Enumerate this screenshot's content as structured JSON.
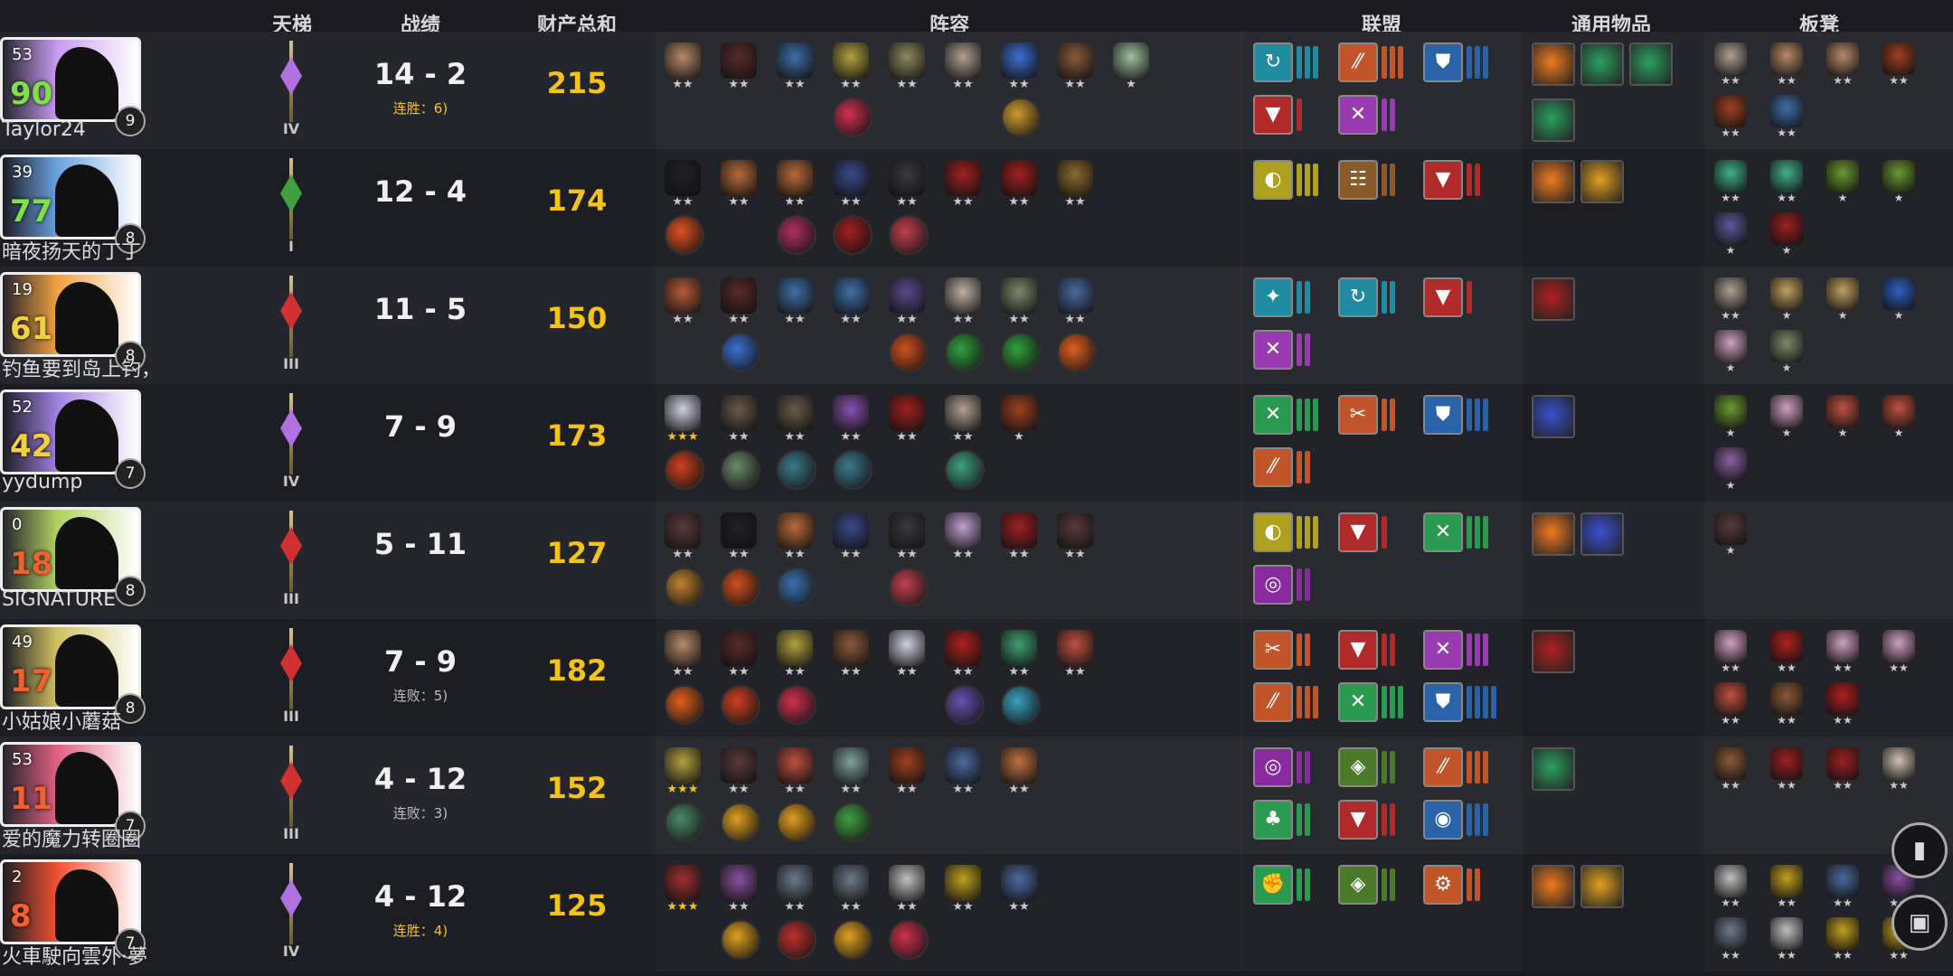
{
  "headers": {
    "ladder": "天梯",
    "record": "战绩",
    "networth": "财产总和",
    "lineup": "阵容",
    "alliances": "联盟",
    "items": "通用物品",
    "bench": "板凳"
  },
  "players": [
    {
      "level": "53",
      "hp": "90",
      "hp_color": "#7ee04a",
      "badge": "9",
      "name": "Taylor24",
      "portrait_color": "#c89af0",
      "rank": "IV",
      "rank_color": "#b070e0",
      "record": "14 - 2",
      "streak": "连胜：6)",
      "streak_type": "win",
      "gold": "215",
      "units": [
        [
          "#b88a6a",
          2
        ],
        [
          "#5a2a2a",
          2
        ],
        [
          "#3f6fa8",
          2
        ],
        [
          "#b4a040",
          2
        ],
        [
          "#8f8a5e",
          2
        ],
        [
          "#b0a090",
          2
        ],
        [
          "#3d6fd0",
          2
        ],
        [
          "#8a5a3a",
          2
        ],
        [
          "#a0c0a0",
          1
        ]
      ],
      "uitems": [
        {
          "slot": 3,
          "color": "#d03050"
        },
        {
          "slot": 6,
          "color": "#d09a30"
        }
      ],
      "syn": [
        {
          "c": "#1f8aa0",
          "g": "↻",
          "n": 3
        },
        {
          "c": "#c2542a",
          "g": "⁄⁄",
          "n": 3
        },
        {
          "c": "#2a62a8",
          "g": "⛊",
          "n": 3
        },
        {
          "c": "#b02a2a",
          "g": "▼",
          "n": 1
        },
        {
          "c": "#9a3ab0",
          "g": "✕",
          "n": 2
        }
      ],
      "gitems": [
        "#f07a20",
        "#2aa060",
        "#2aa060",
        "#2aa060"
      ],
      "bench": [
        [
          "#b0a090",
          2
        ],
        [
          "#b88a6a",
          2
        ],
        [
          "#b88a6a",
          2
        ],
        [
          "#a04020",
          2
        ],
        [
          "#a04020",
          2
        ],
        [
          "#3f6fa8",
          2
        ]
      ]
    },
    {
      "level": "39",
      "hp": "77",
      "hp_color": "#7ee04a",
      "badge": "8",
      "name": "暗夜扬天的丁丁",
      "portrait_color": "#6aa0e0",
      "rank": "I",
      "rank_color": "#40a040",
      "record": "12 - 4",
      "streak": "",
      "streak_type": "win",
      "gold": "174",
      "units": [
        [
          "#202028",
          2
        ],
        [
          "#b86a3a",
          2
        ],
        [
          "#b86a3a",
          2
        ],
        [
          "#3a4a8a",
          2
        ],
        [
          "#3a3a40",
          2
        ],
        [
          "#a02020",
          2
        ],
        [
          "#a02020",
          2
        ],
        [
          "#8a6a30",
          2
        ]
      ],
      "uitems": [
        {
          "slot": 0,
          "color": "#e05020"
        },
        {
          "slot": 2,
          "color": "#b03060"
        },
        {
          "slot": 3,
          "color": "#a02020"
        },
        {
          "slot": 4,
          "color": "#c04050"
        }
      ],
      "syn": [
        {
          "c": "#b0a020",
          "g": "◐",
          "n": 3
        },
        {
          "c": "#8a5a2a",
          "g": "☷",
          "n": 2
        },
        {
          "c": "#b02a2a",
          "g": "▼",
          "n": 2
        }
      ],
      "gitems": [
        "#f07a20",
        "#e0a020"
      ],
      "bench": [
        [
          "#40b08a",
          2
        ],
        [
          "#40b08a",
          2
        ],
        [
          "#6a9a30",
          1
        ],
        [
          "#6a9a30",
          1
        ],
        [
          "#5a5a9a",
          1
        ],
        [
          "#a02020",
          1
        ]
      ]
    },
    {
      "level": "19",
      "hp": "61",
      "hp_color": "#f0d040",
      "badge": "8",
      "name": "钓鱼要到岛上钓，",
      "portrait_color": "#f0a040",
      "rank": "III",
      "rank_color": "#d03030",
      "record": "11 - 5",
      "streak": "",
      "streak_type": "win",
      "gold": "150",
      "units": [
        [
          "#b85a3a",
          2
        ],
        [
          "#5a2a2a",
          2
        ],
        [
          "#3f6fa8",
          2
        ],
        [
          "#3f6fa8",
          2
        ],
        [
          "#5a4a8a",
          2
        ],
        [
          "#c0b0a0",
          2
        ],
        [
          "#7a8a6a",
          2
        ],
        [
          "#4a6aa0",
          2
        ]
      ],
      "uitems": [
        {
          "slot": 1,
          "color": "#3a70d0"
        },
        {
          "slot": 4,
          "color": "#d05020"
        },
        {
          "slot": 5,
          "color": "#30a040"
        },
        {
          "slot": 6,
          "color": "#30a040"
        },
        {
          "slot": 7,
          "color": "#e06020"
        }
      ],
      "syn": [
        {
          "c": "#1f8aa0",
          "g": "✦",
          "n": 2
        },
        {
          "c": "#1f8aa0",
          "g": "↻",
          "n": 2
        },
        {
          "c": "#b02a2a",
          "g": "▼",
          "n": 1
        },
        {
          "c": "#9a3ab0",
          "g": "✕",
          "n": 2
        }
      ],
      "gitems": [
        "#b02020"
      ],
      "bench": [
        [
          "#b0a090",
          2
        ],
        [
          "#c0a060",
          1
        ],
        [
          "#c0a060",
          1
        ],
        [
          "#3060c0",
          1
        ],
        [
          "#d0a0c0",
          1
        ],
        [
          "#7a8a6a",
          1
        ]
      ]
    },
    {
      "level": "52",
      "hp": "42",
      "hp_color": "#f0d040",
      "badge": "7",
      "name": "yydump",
      "portrait_color": "#a080e0",
      "rank": "IV",
      "rank_color": "#b070e0",
      "record": "7 - 9",
      "streak": "",
      "streak_type": "win",
      "gold": "173",
      "units": [
        [
          "#d0d0e0",
          3
        ],
        [
          "#6a5a4a",
          2
        ],
        [
          "#6a5a4a",
          2
        ],
        [
          "#8a50b0",
          2
        ],
        [
          "#a02020",
          2
        ],
        [
          "#b0a090",
          2
        ],
        [
          "#a04020",
          1
        ]
      ],
      "uitems": [
        {
          "slot": 0,
          "color": "#d04020"
        },
        {
          "slot": 1,
          "color": "#6a8a6a"
        },
        {
          "slot": 2,
          "color": "#3a7a8a"
        },
        {
          "slot": 3,
          "color": "#3a7a8a"
        },
        {
          "slot": 5,
          "color": "#40a080"
        }
      ],
      "syn": [
        {
          "c": "#2a9a50",
          "g": "✕",
          "n": 3
        },
        {
          "c": "#c2542a",
          "g": "✂",
          "n": 2
        },
        {
          "c": "#2a62a8",
          "g": "⛊",
          "n": 3
        },
        {
          "c": "#c2542a",
          "g": "⁄⁄",
          "n": 2
        }
      ],
      "gitems": [
        "#3a50d0"
      ],
      "bench": [
        [
          "#6a9a30",
          1
        ],
        [
          "#d0a0c0",
          1
        ],
        [
          "#c05040",
          1
        ],
        [
          "#c05040",
          1
        ],
        [
          "#8a60a0",
          1
        ]
      ]
    },
    {
      "level": "0",
      "hp": "18",
      "hp_color": "#f06030",
      "badge": "8",
      "name": "SIGNATURE",
      "portrait_color": "#b0d060",
      "rank": "III",
      "rank_color": "#d03030",
      "record": "5 - 11",
      "streak": "",
      "streak_type": "win",
      "gold": "127",
      "units": [
        [
          "#5a3a3a",
          2
        ],
        [
          "#202028",
          2
        ],
        [
          "#b86a3a",
          2
        ],
        [
          "#3a4a8a",
          2
        ],
        [
          "#3a3a40",
          2
        ],
        [
          "#c0a0d0",
          2
        ],
        [
          "#a02020",
          2
        ],
        [
          "#5a3a3a",
          2
        ]
      ],
      "uitems": [
        {
          "slot": 0,
          "color": "#c08030"
        },
        {
          "slot": 1,
          "color": "#d05020"
        },
        {
          "slot": 2,
          "color": "#3a70b0"
        },
        {
          "slot": 4,
          "color": "#c04050"
        }
      ],
      "syn": [
        {
          "c": "#b0a020",
          "g": "◐",
          "n": 3
        },
        {
          "c": "#b02a2a",
          "g": "▼",
          "n": 1
        },
        {
          "c": "#2a9a50",
          "g": "✕",
          "n": 3
        },
        {
          "c": "#8a2aa0",
          "g": "◎",
          "n": 2
        }
      ],
      "gitems": [
        "#f07a20",
        "#3a50d0"
      ],
      "bench": [
        [
          "#5a3a3a",
          1
        ]
      ]
    },
    {
      "level": "49",
      "hp": "17",
      "hp_color": "#f06030",
      "badge": "8",
      "name": "小姑娘小蘑菇",
      "portrait_color": "#d0c060",
      "rank": "III",
      "rank_color": "#d03030",
      "record": "7 - 9",
      "streak": "连败：5)",
      "streak_type": "loss",
      "gold": "182",
      "units": [
        [
          "#b88a6a",
          2
        ],
        [
          "#5a2a2a",
          2
        ],
        [
          "#b4a040",
          2
        ],
        [
          "#8a5a3a",
          2
        ],
        [
          "#d0d0e0",
          2
        ],
        [
          "#b02020",
          2
        ],
        [
          "#40a070",
          2
        ],
        [
          "#c05040",
          2
        ]
      ],
      "uitems": [
        {
          "slot": 0,
          "color": "#e06020"
        },
        {
          "slot": 1,
          "color": "#d04020"
        },
        {
          "slot": 2,
          "color": "#d03050"
        },
        {
          "slot": 5,
          "color": "#6a50b0"
        },
        {
          "slot": 6,
          "color": "#3aa0c0"
        }
      ],
      "syn": [
        {
          "c": "#c2542a",
          "g": "✂",
          "n": 2
        },
        {
          "c": "#b02a2a",
          "g": "▼",
          "n": 2
        },
        {
          "c": "#9a3ab0",
          "g": "✕",
          "n": 3
        },
        {
          "c": "#c2542a",
          "g": "⁄⁄",
          "n": 3
        },
        {
          "c": "#2a9a50",
          "g": "✕",
          "n": 3
        },
        {
          "c": "#2a62a8",
          "g": "⛊",
          "n": 4
        }
      ],
      "gitems": [
        "#b02020"
      ],
      "bench": [
        [
          "#d0a0c0",
          2
        ],
        [
          "#b02020",
          2
        ],
        [
          "#d0a0c0",
          2
        ],
        [
          "#d0a0c0",
          2
        ],
        [
          "#c05040",
          2
        ],
        [
          "#8a5a3a",
          2
        ],
        [
          "#b02020",
          2
        ]
      ]
    },
    {
      "level": "53",
      "hp": "11",
      "hp_color": "#f06030",
      "badge": "7",
      "name": "爱的魔力转圈圈",
      "portrait_color": "#e06080",
      "rank": "III",
      "rank_color": "#d03030",
      "record": "4 - 12",
      "streak": "连败：3)",
      "streak_type": "loss",
      "gold": "152",
      "units": [
        [
          "#b4a040",
          3
        ],
        [
          "#5a3a3a",
          2
        ],
        [
          "#c05040",
          2
        ],
        [
          "#80a0a0",
          2
        ],
        [
          "#a04020",
          2
        ],
        [
          "#4a6aa0",
          2
        ],
        [
          "#c07040",
          2
        ]
      ],
      "uitems": [
        {
          "slot": 0,
          "color": "#4a8a6a"
        },
        {
          "slot": 1,
          "color": "#e0a020"
        },
        {
          "slot": 2,
          "color": "#e0a020"
        },
        {
          "slot": 3,
          "color": "#40a040"
        }
      ],
      "syn": [
        {
          "c": "#8a2aa0",
          "g": "◎",
          "n": 2
        },
        {
          "c": "#4a7a2a",
          "g": "◈",
          "n": 2
        },
        {
          "c": "#c2542a",
          "g": "⁄⁄",
          "n": 3
        },
        {
          "c": "#2a9a50",
          "g": "♣",
          "n": 2
        },
        {
          "c": "#b02a2a",
          "g": "▼",
          "n": 2
        },
        {
          "c": "#2a62a8",
          "g": "◉",
          "n": 3
        }
      ],
      "gitems": [
        "#2aa060"
      ],
      "bench": [
        [
          "#8a5a3a",
          2
        ],
        [
          "#a02020",
          2
        ],
        [
          "#a02020",
          2
        ],
        [
          "#d0c0b0",
          2
        ]
      ]
    },
    {
      "level": "2",
      "hp": "8",
      "hp_color": "#f06030",
      "badge": "7",
      "name": "火車駛向雲外·夢",
      "portrait_color": "#f05030",
      "rank": "IV",
      "rank_color": "#b070e0",
      "record": "4 - 12",
      "streak": "连胜：4)",
      "streak_type": "win",
      "gold": "125",
      "units": [
        [
          "#a03030",
          3
        ],
        [
          "#8a50a0",
          2
        ],
        [
          "#6a7a8a",
          2
        ],
        [
          "#6a7a8a",
          2
        ],
        [
          "#c0c0c0",
          2
        ],
        [
          "#c0a020",
          2
        ],
        [
          "#4a6aa0",
          2
        ]
      ],
      "uitems": [
        {
          "slot": 1,
          "color": "#e0a020"
        },
        {
          "slot": 2,
          "color": "#c03030"
        },
        {
          "slot": 3,
          "color": "#e0a020"
        },
        {
          "slot": 4,
          "color": "#d03050"
        }
      ],
      "syn": [
        {
          "c": "#2a9a50",
          "g": "✊",
          "n": 2
        },
        {
          "c": "#4a7a2a",
          "g": "◈",
          "n": 2
        },
        {
          "c": "#c2542a",
          "g": "⚙",
          "n": 2
        }
      ],
      "gitems": [
        "#f07a20",
        "#e0a020"
      ],
      "bench": [
        [
          "#c0c0c0",
          2
        ],
        [
          "#c0a020",
          2
        ],
        [
          "#4a6aa0",
          2
        ],
        [
          "#8a50a0",
          2
        ],
        [
          "#6a7a8a",
          2
        ],
        [
          "#c0c0c0",
          2
        ],
        [
          "#c0a020",
          2
        ],
        [
          "#c0a020",
          2
        ]
      ]
    }
  ]
}
